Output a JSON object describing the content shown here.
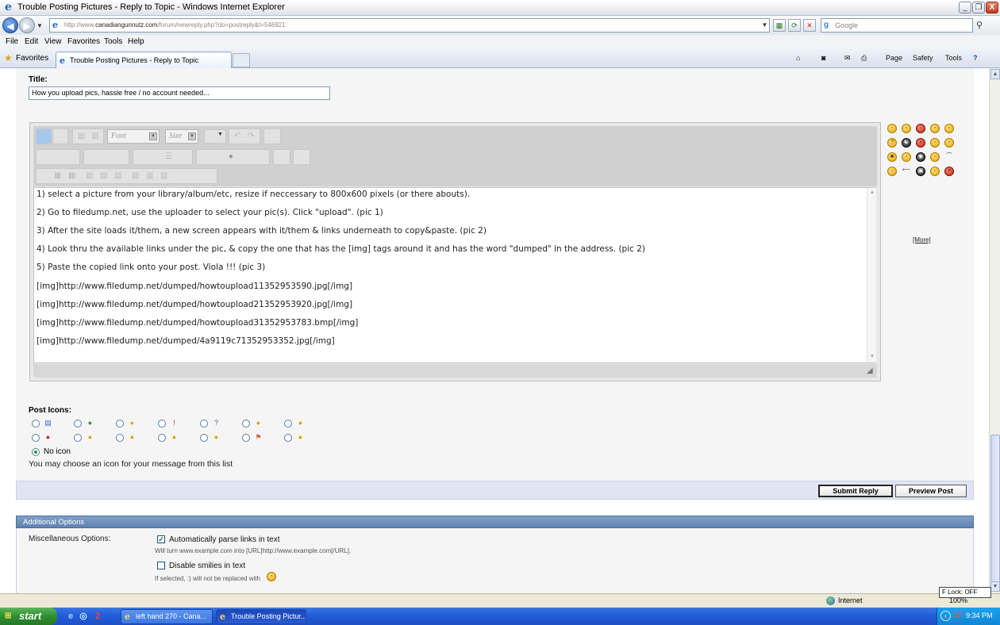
{
  "window": {
    "title": "Trouble Posting Pictures - Reply to Topic - Windows Internet Explorer",
    "minimize": "_",
    "restore": "❐",
    "close": "X"
  },
  "address": {
    "url_prefix": "http://www.",
    "url_domain": "canadiangunnutz.com",
    "url_path": "/forum/newreply.php?do=postreply&t=546921",
    "search_placeholder": "Google"
  },
  "menu": [
    "File",
    "Edit",
    "View",
    "Favorites",
    "Tools",
    "Help"
  ],
  "tabs": {
    "favorites_label": "Favorites",
    "active_tab": "Trouble Posting Pictures - Reply to Topic"
  },
  "command_bar": {
    "page": "Page",
    "safety": "Safety",
    "tools": "Tools",
    "help": "?"
  },
  "form": {
    "title_label": "Title:",
    "title_value": "How you upload pics, hassle free / no account needed...",
    "font_placeholder": "Font",
    "size_placeholder": "Size",
    "message_lines": [
      "1) select a picture from your library/album/etc, resize if neccessary to 800x600 pixels (or there abouts).",
      "2) Go to filedump.net, use the uploader to select your pic(s). Click \"upload\". (pic 1)",
      "3) After the site loads it/them, a new screen appears with it/them & links underneath to copy&paste. (pic 2)",
      "4) Look thru the available links under the pic, & copy the one that has the [img] tags around it and has the word \"dumped\" in the address. (pic 2)",
      "5) Paste the copied link onto your post. Viola !!! (pic 3)",
      "[img]http://www.filedump.net/dumped/howtoupload11352953590.jpg[/img]",
      "[img]http://www.filedump.net/dumped/howtoupload21352953920.jpg[/img]",
      "[img]http://www.filedump.net/dumped/howtoupload31352953783.bmp[/img]",
      "[img]http://www.filedump.net/dumped/4a9119c71352953352.jpg[/img]"
    ],
    "smilies_more": "[More]",
    "post_icons_label": "Post Icons:",
    "no_icon_label": "No icon",
    "post_icons_help": "You may choose an icon for your message from this list",
    "submit_label": "Submit Reply",
    "preview_label": "Preview Post"
  },
  "additional_options": {
    "header": "Additional Options",
    "misc_label": "Miscellaneous Options:",
    "parse_links_label": "Automatically parse links in text",
    "parse_links_help": "Will turn www.example.com into [URL]http://www.example.com[/URL].",
    "parse_links_checked": true,
    "disable_smilies_label": "Disable smilies in text",
    "disable_smilies_help": "If selected, :) will not be replaced with",
    "disable_smilies_checked": false
  },
  "status": {
    "zone": "Internet",
    "zoom": "100%",
    "flock": "F Lock: OFF"
  },
  "taskbar": {
    "start": "start",
    "items": [
      "left hand 270 - Cana...",
      "Trouble Posting Pictur..."
    ],
    "badge": "37",
    "clock": "9:34 PM"
  }
}
